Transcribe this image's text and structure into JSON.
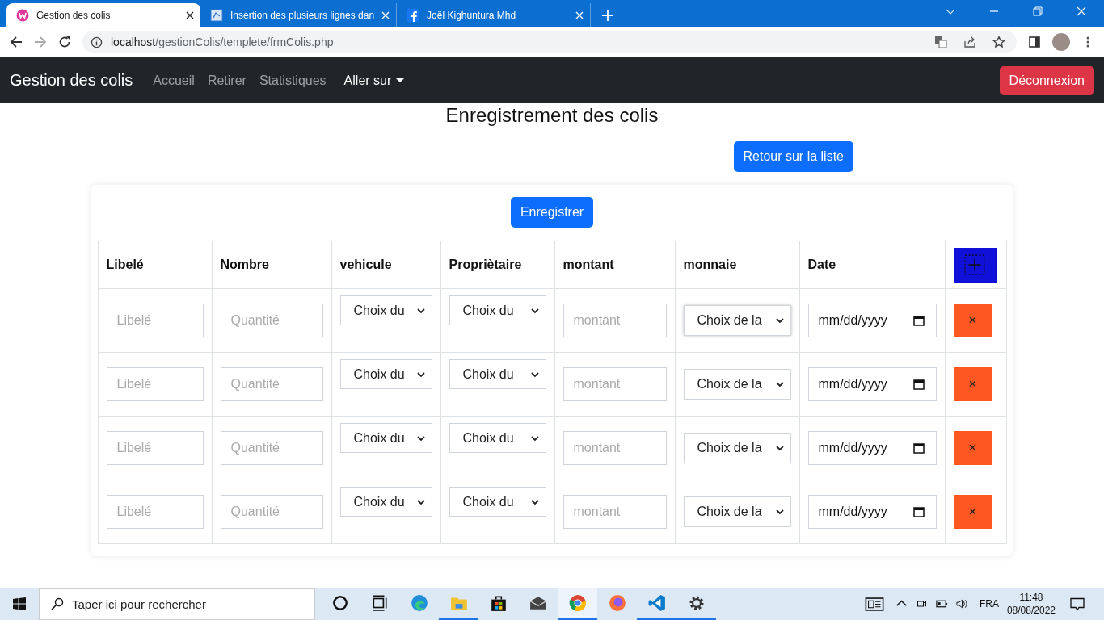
{
  "browser": {
    "tabs": [
      {
        "title": "Gestion des colis",
        "kind": "wamp",
        "selected": true
      },
      {
        "title": "Insertion des plusieurs lignes dan",
        "kind": "doc",
        "selected": false
      },
      {
        "title": "Joël Kighuntura Mhd",
        "kind": "facebook",
        "selected": false
      }
    ],
    "url": {
      "host": "localhost",
      "path": "/gestionColis/templete/frmColis.php"
    }
  },
  "navbar": {
    "brand": "Gestion des colis",
    "links": [
      {
        "label": "Accueil"
      },
      {
        "label": "Retirer"
      },
      {
        "label": "Statistiques"
      }
    ],
    "dropdown": "Aller sur",
    "logout": "Déconnexion"
  },
  "page": {
    "title": "Enregistrement des colis",
    "back_button": "Retour sur la liste",
    "save_button": "Enregistrer"
  },
  "table": {
    "columns": [
      "Libelé",
      "Nombre",
      "vehicule",
      "Propriètaire",
      "montant",
      "monnaie",
      "Date"
    ],
    "rows": [
      {
        "label_placeholder": "Libelé",
        "quantity_placeholder": "Quantité",
        "vehicle": "Choix du",
        "owner": "Choix du",
        "amount_placeholder": "montant",
        "currency": "Choix de la",
        "currency_focused": true,
        "date": "mm/dd/yyyy",
        "delete": "×"
      },
      {
        "label_placeholder": "Libelé",
        "quantity_placeholder": "Quantité",
        "vehicle": "Choix du",
        "owner": "Choix du",
        "amount_placeholder": "montant",
        "currency": "Choix de la",
        "currency_focused": false,
        "date": "mm/dd/yyyy",
        "delete": "×"
      },
      {
        "label_placeholder": "Libelé",
        "quantity_placeholder": "Quantité",
        "vehicle": "Choix du",
        "owner": "Choix du",
        "amount_placeholder": "montant",
        "currency": "Choix de la",
        "currency_focused": false,
        "date": "mm/dd/yyyy",
        "delete": "×"
      },
      {
        "label_placeholder": "Libelé",
        "quantity_placeholder": "Quantité",
        "vehicle": "Choix du",
        "owner": "Choix du",
        "amount_placeholder": "montant",
        "currency": "Choix de la",
        "currency_focused": false,
        "date": "mm/dd/yyyy",
        "delete": "×"
      }
    ]
  },
  "taskbar": {
    "search_placeholder": "Taper ici pour rechercher",
    "apps": [
      {
        "kind": "cortana",
        "running": false,
        "selected": false
      },
      {
        "kind": "taskview",
        "running": false,
        "selected": false
      },
      {
        "kind": "edge",
        "running": false,
        "selected": false
      },
      {
        "kind": "explorer",
        "running": true,
        "selected": false
      },
      {
        "kind": "store",
        "running": false,
        "selected": false
      },
      {
        "kind": "mail",
        "running": false,
        "selected": false
      },
      {
        "kind": "chrome",
        "running": true,
        "selected": true
      },
      {
        "kind": "firefox",
        "running": false,
        "selected": false
      },
      {
        "kind": "vscode",
        "running": true,
        "selected": false
      },
      {
        "kind": "settings",
        "running": true,
        "selected": false
      }
    ],
    "language": "FRA",
    "time": "11:48",
    "date": "08/08/2022"
  }
}
